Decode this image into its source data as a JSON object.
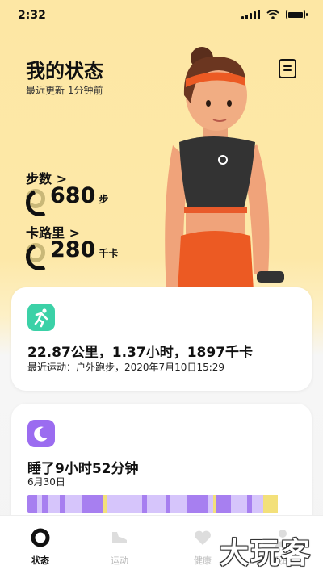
{
  "status_bar": {
    "time": "2:32"
  },
  "header": {
    "title": "我的状态",
    "subtitle": "最近更新 1分钟前"
  },
  "metrics": {
    "steps": {
      "label": "步数 >",
      "value": "680",
      "unit": "步",
      "progress": 0.25
    },
    "calories": {
      "label": "卡路里 >",
      "value": "280",
      "unit": "千卡",
      "progress": 0.2
    }
  },
  "activity_card": {
    "summary": "22.87公里，1.37小时，1897千卡",
    "detail": "最近运动：户外跑步，2020年7月10日15:29",
    "icon": "running-icon",
    "color": "#3bd1a7"
  },
  "sleep_card": {
    "summary": "睡了9小时52分钟",
    "date": "6月30日",
    "icon": "moon-icon",
    "color": "#9b6cf0"
  },
  "tabs": [
    {
      "label": "状态",
      "icon": "status-ring-icon",
      "active": true
    },
    {
      "label": "运动",
      "icon": "shoe-icon",
      "active": false
    },
    {
      "label": "健康",
      "icon": "heart-icon",
      "active": false
    },
    {
      "label": "我的",
      "icon": "person-icon",
      "active": false
    }
  ],
  "watermark": "大玩客",
  "colors": {
    "background_top": "#fde7a4",
    "sleep_deep": "#a77ff0",
    "sleep_light": "#d6c5fb",
    "sleep_awake": "#f3e07a"
  }
}
